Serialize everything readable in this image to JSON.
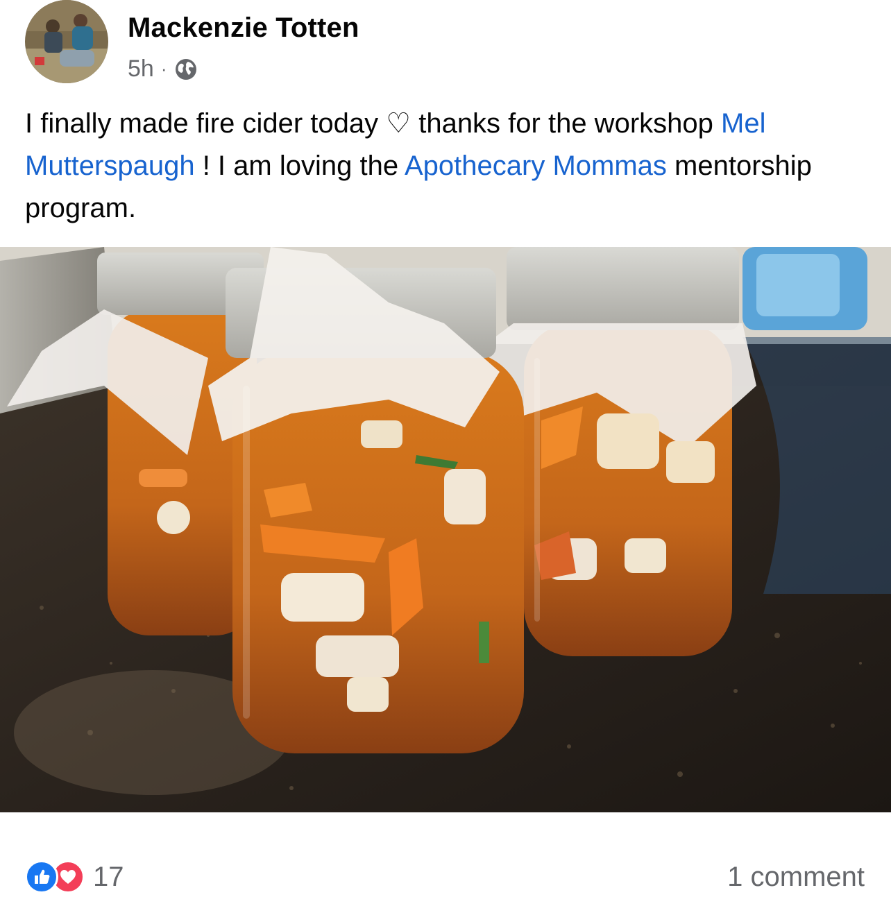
{
  "post": {
    "author": "Mackenzie Totten",
    "time": "5h",
    "separator": "·",
    "audience_icon": "globe-icon",
    "text_before_mention1": "I finally made fire cider today ♡ thanks for the workshop ",
    "mention1": "Mel Mutterspaugh",
    "text_between_mentions": " ! I am loving the  ",
    "mention2": "Apothecary Mommas",
    "text_after_mention2": " mentorship program."
  },
  "footer": {
    "reaction_icons": [
      "like-icon",
      "love-icon"
    ],
    "reaction_count": "17",
    "comments": "1 comment"
  },
  "colors": {
    "mention": "#1763cf",
    "secondary_text": "#65676b",
    "like": "#1877f2",
    "love": "#f33e58"
  }
}
